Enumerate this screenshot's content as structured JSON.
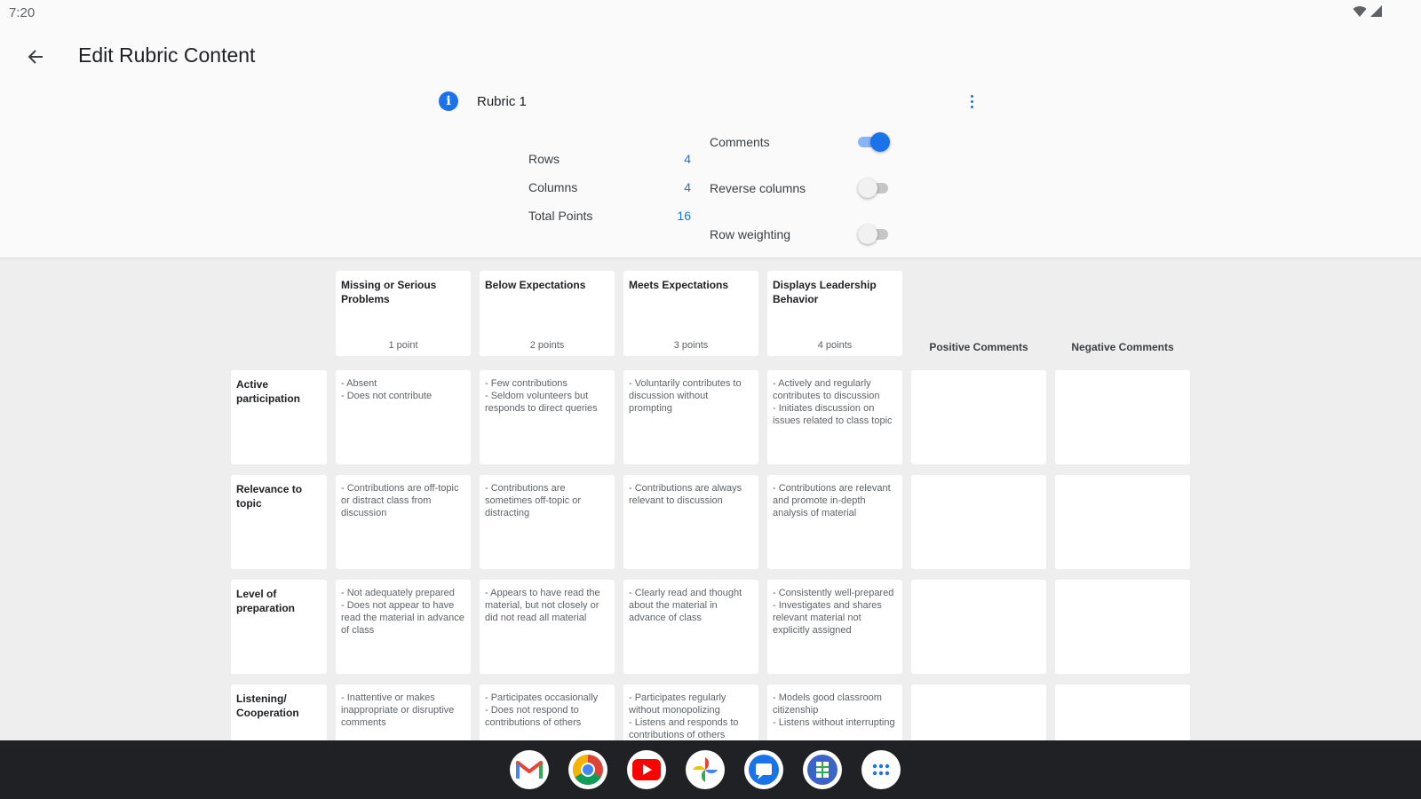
{
  "status": {
    "time": "7:20"
  },
  "header": {
    "title": "Edit Rubric Content"
  },
  "rubric": {
    "name": "Rubric 1"
  },
  "settings": {
    "rows_label": "Rows",
    "rows_value": "4",
    "columns_label": "Columns",
    "columns_value": "4",
    "total_label": "Total Points",
    "total_value": "16",
    "comments_label": "Comments",
    "reverse_label": "Reverse columns",
    "weighting_label": "Row weighting"
  },
  "columns": [
    {
      "title": "Missing or Serious Problems",
      "points": "1 point"
    },
    {
      "title": "Below Expectations",
      "points": "2 points"
    },
    {
      "title": "Meets Expectations",
      "points": "3 points"
    },
    {
      "title": "Displays Leadership Behavior",
      "points": "4 points"
    }
  ],
  "extra_columns": [
    "Positive Comments",
    "Negative Comments"
  ],
  "rows": [
    {
      "title": "Active participation",
      "cells": [
        "- Absent\n- Does not contribute",
        "- Few contributions\n- Seldom volunteers but responds to direct queries",
        "- Voluntarily contributes to discussion without prompting",
        "- Actively and regularly contributes to discussion\n- Initiates discussion on issues related to class topic"
      ]
    },
    {
      "title": "Relevance to topic",
      "cells": [
        "- Contributions are off-topic or distract class from discussion",
        "- Contributions are sometimes off-topic or distracting",
        "- Contributions are always relevant to discussion",
        "- Contributions are relevant and promote in-depth analysis of material"
      ]
    },
    {
      "title": "Level of preparation",
      "cells": [
        "- Not adequately prepared\n- Does not appear to have read the material in advance of class",
        "- Appears to have read the material, but not closely or did not read all material",
        "- Clearly read and thought about the material in advance of class",
        "- Consistently well-prepared\n- Investigates and shares relevant material not explicitly assigned"
      ]
    },
    {
      "title": "Listening/ Cooperation",
      "cells": [
        "- Inattentive or makes inappropriate or disruptive comments",
        "- Participates occasionally\n- Does not respond to contributions of others",
        "- Participates regularly without monopolizing\n- Listens and responds to contributions of others",
        "- Models good classroom citizenship\n- Listens without interrupting"
      ]
    }
  ],
  "dock": [
    "gmail-icon",
    "chrome-icon",
    "youtube-icon",
    "photos-icon",
    "messages-icon",
    "sheets-icon",
    "apps-grid-icon"
  ],
  "colors": {
    "accent": "#1a73e8",
    "taskbar": "#202124",
    "panel": "#fafafa",
    "grid_bg": "#eeeeee"
  }
}
